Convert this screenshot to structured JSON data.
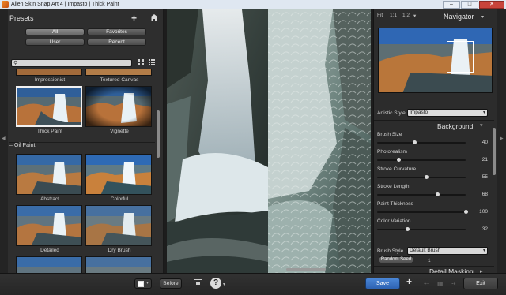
{
  "window": {
    "title": "Alien Skin Snap Art 4 | Impasto | Thick Paint",
    "minimize": "–",
    "maximize": "□",
    "close": "✕"
  },
  "presets": {
    "title": "Presets",
    "filters": [
      "All",
      "Favorites",
      "User",
      "Recent"
    ],
    "active_filter": "All",
    "search_placeholder": "",
    "tiles": [
      {
        "label": "Impressionist"
      },
      {
        "label": "Textured Canvas"
      },
      {
        "label": "Thick Paint",
        "selected": true
      },
      {
        "label": "Vignette"
      }
    ],
    "section": "Oil Paint",
    "oil_tiles": [
      {
        "label": "Abstract"
      },
      {
        "label": "Colorful"
      },
      {
        "label": "Detailed"
      },
      {
        "label": "Dry Brush"
      }
    ]
  },
  "navigator": {
    "zoom_fit": "Fit",
    "zoom_1": "1:1",
    "zoom_2": "1:2",
    "zoom_caret": "▾",
    "title": "Navigator",
    "menu_caret": "▾"
  },
  "settings": {
    "artistic_style_label": "Artistic Style:",
    "artistic_style_value": "Impasto",
    "background_title": "Background",
    "params": [
      {
        "name": "Brush Size",
        "value": "40",
        "level": 0.42
      },
      {
        "name": "Photorealism",
        "value": "21",
        "level": 0.24
      },
      {
        "name": "Stroke Curvature",
        "value": "55",
        "level": 0.55
      },
      {
        "name": "Stroke Length",
        "value": "68",
        "level": 0.68
      },
      {
        "name": "Paint Thickness",
        "value": "100",
        "level": 1.0
      },
      {
        "name": "Color Variation",
        "value": "32",
        "level": 0.34
      }
    ],
    "brush_style_label": "Brush Style",
    "brush_style_value": "Default Brush",
    "random_seed_label": "Random Seed",
    "random_seed_value": "1",
    "detail_masking_title": "Detail Masking"
  },
  "bottom": {
    "before_label": "Before",
    "save_label": "Save",
    "exit_label": "Exit",
    "help_label": "?"
  }
}
